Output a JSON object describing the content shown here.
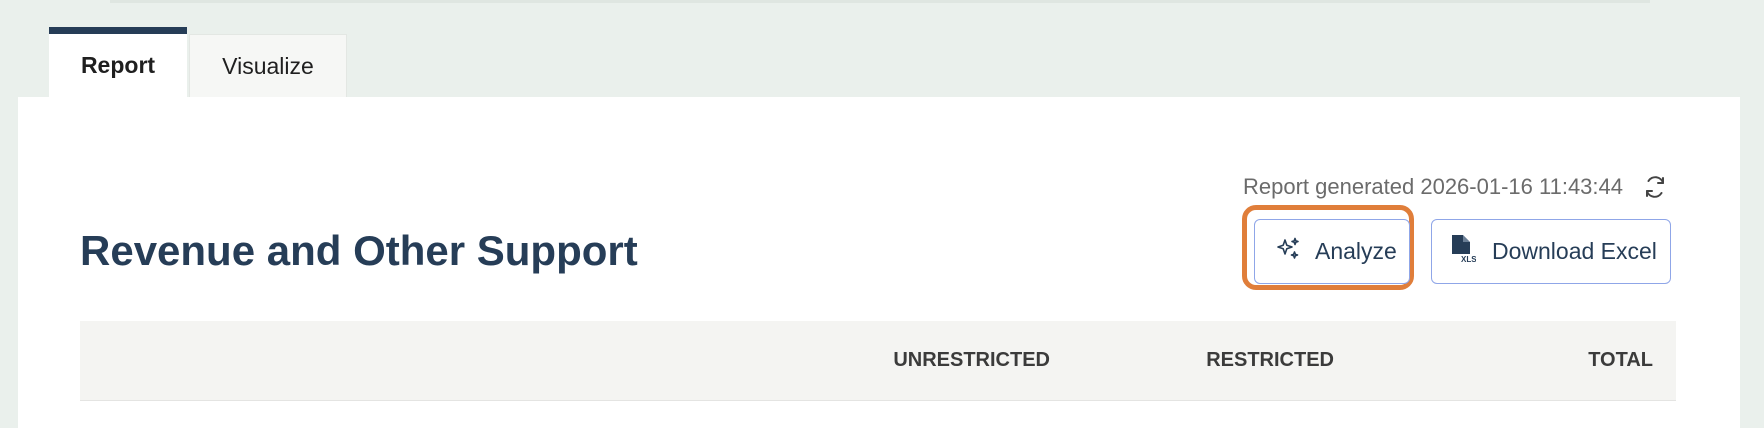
{
  "tabs": [
    {
      "label": "Report",
      "active": true
    },
    {
      "label": "Visualize",
      "active": false
    }
  ],
  "report": {
    "generated_label": "Report generated 2026-01-16 11:43:44",
    "title": "Revenue and Other Support"
  },
  "actions": {
    "analyze_label": "Analyze",
    "download_excel_label": "Download Excel"
  },
  "table": {
    "columns": [
      "",
      "UNRESTRICTED",
      "RESTRICTED",
      "TOTAL"
    ]
  },
  "icons": {
    "refresh": "refresh-icon",
    "analyze": "sparkle-icon",
    "excel": "xls-file-icon"
  },
  "colors": {
    "brand": "#263d57",
    "button_border": "#8fa6e8",
    "highlight": "#e07e3a"
  }
}
